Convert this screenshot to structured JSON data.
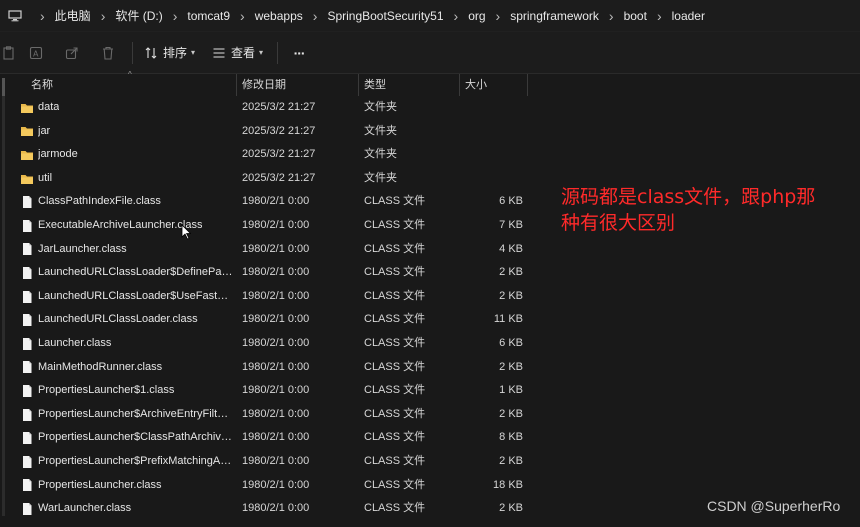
{
  "breadcrumb": [
    "此电脑",
    "软件 (D:)",
    "tomcat9",
    "webapps",
    "SpringBootSecurity51",
    "org",
    "springframework",
    "boot",
    "loader"
  ],
  "toolbar": {
    "sort_label": "排序",
    "view_label": "查看",
    "more_label": "···"
  },
  "columns": {
    "name": "名称",
    "date": "修改日期",
    "type": "类型",
    "size": "大小"
  },
  "rows": [
    {
      "kind": "folder",
      "name": "data",
      "date": "2025/3/2 21:27",
      "type": "文件夹",
      "size": ""
    },
    {
      "kind": "folder",
      "name": "jar",
      "date": "2025/3/2 21:27",
      "type": "文件夹",
      "size": ""
    },
    {
      "kind": "folder",
      "name": "jarmode",
      "date": "2025/3/2 21:27",
      "type": "文件夹",
      "size": ""
    },
    {
      "kind": "folder",
      "name": "util",
      "date": "2025/3/2 21:27",
      "type": "文件夹",
      "size": ""
    },
    {
      "kind": "file",
      "name": "ClassPathIndexFile.class",
      "date": "1980/2/1 0:00",
      "type": "CLASS 文件",
      "size": "6 KB"
    },
    {
      "kind": "file",
      "name": "ExecutableArchiveLauncher.class",
      "date": "1980/2/1 0:00",
      "type": "CLASS 文件",
      "size": "7 KB"
    },
    {
      "kind": "file",
      "name": "JarLauncher.class",
      "date": "1980/2/1 0:00",
      "type": "CLASS 文件",
      "size": "4 KB"
    },
    {
      "kind": "file",
      "name": "LaunchedURLClassLoader$DefinePackageC...",
      "date": "1980/2/1 0:00",
      "type": "CLASS 文件",
      "size": "2 KB"
    },
    {
      "kind": "file",
      "name": "LaunchedURLClassLoader$UseFastConnecti...",
      "date": "1980/2/1 0:00",
      "type": "CLASS 文件",
      "size": "2 KB"
    },
    {
      "kind": "file",
      "name": "LaunchedURLClassLoader.class",
      "date": "1980/2/1 0:00",
      "type": "CLASS 文件",
      "size": "11 KB"
    },
    {
      "kind": "file",
      "name": "Launcher.class",
      "date": "1980/2/1 0:00",
      "type": "CLASS 文件",
      "size": "6 KB"
    },
    {
      "kind": "file",
      "name": "MainMethodRunner.class",
      "date": "1980/2/1 0:00",
      "type": "CLASS 文件",
      "size": "2 KB"
    },
    {
      "kind": "file",
      "name": "PropertiesLauncher$1.class",
      "date": "1980/2/1 0:00",
      "type": "CLASS 文件",
      "size": "1 KB"
    },
    {
      "kind": "file",
      "name": "PropertiesLauncher$ArchiveEntryFilter.class",
      "date": "1980/2/1 0:00",
      "type": "CLASS 文件",
      "size": "2 KB"
    },
    {
      "kind": "file",
      "name": "PropertiesLauncher$ClassPathArchives.class",
      "date": "1980/2/1 0:00",
      "type": "CLASS 文件",
      "size": "8 KB"
    },
    {
      "kind": "file",
      "name": "PropertiesLauncher$PrefixMatchingArchive...",
      "date": "1980/2/1 0:00",
      "type": "CLASS 文件",
      "size": "2 KB"
    },
    {
      "kind": "file",
      "name": "PropertiesLauncher.class",
      "date": "1980/2/1 0:00",
      "type": "CLASS 文件",
      "size": "18 KB"
    },
    {
      "kind": "file",
      "name": "WarLauncher.class",
      "date": "1980/2/1 0:00",
      "type": "CLASS 文件",
      "size": "2 KB"
    }
  ],
  "annotation": {
    "line1": "源码都是class文件，跟php那",
    "line2": "种有很大区别"
  },
  "watermark": "CSDN @SuperherRo",
  "colors": {
    "background": "#191919",
    "folder": "#e8b84a",
    "annotation": "#ff2a2a"
  }
}
